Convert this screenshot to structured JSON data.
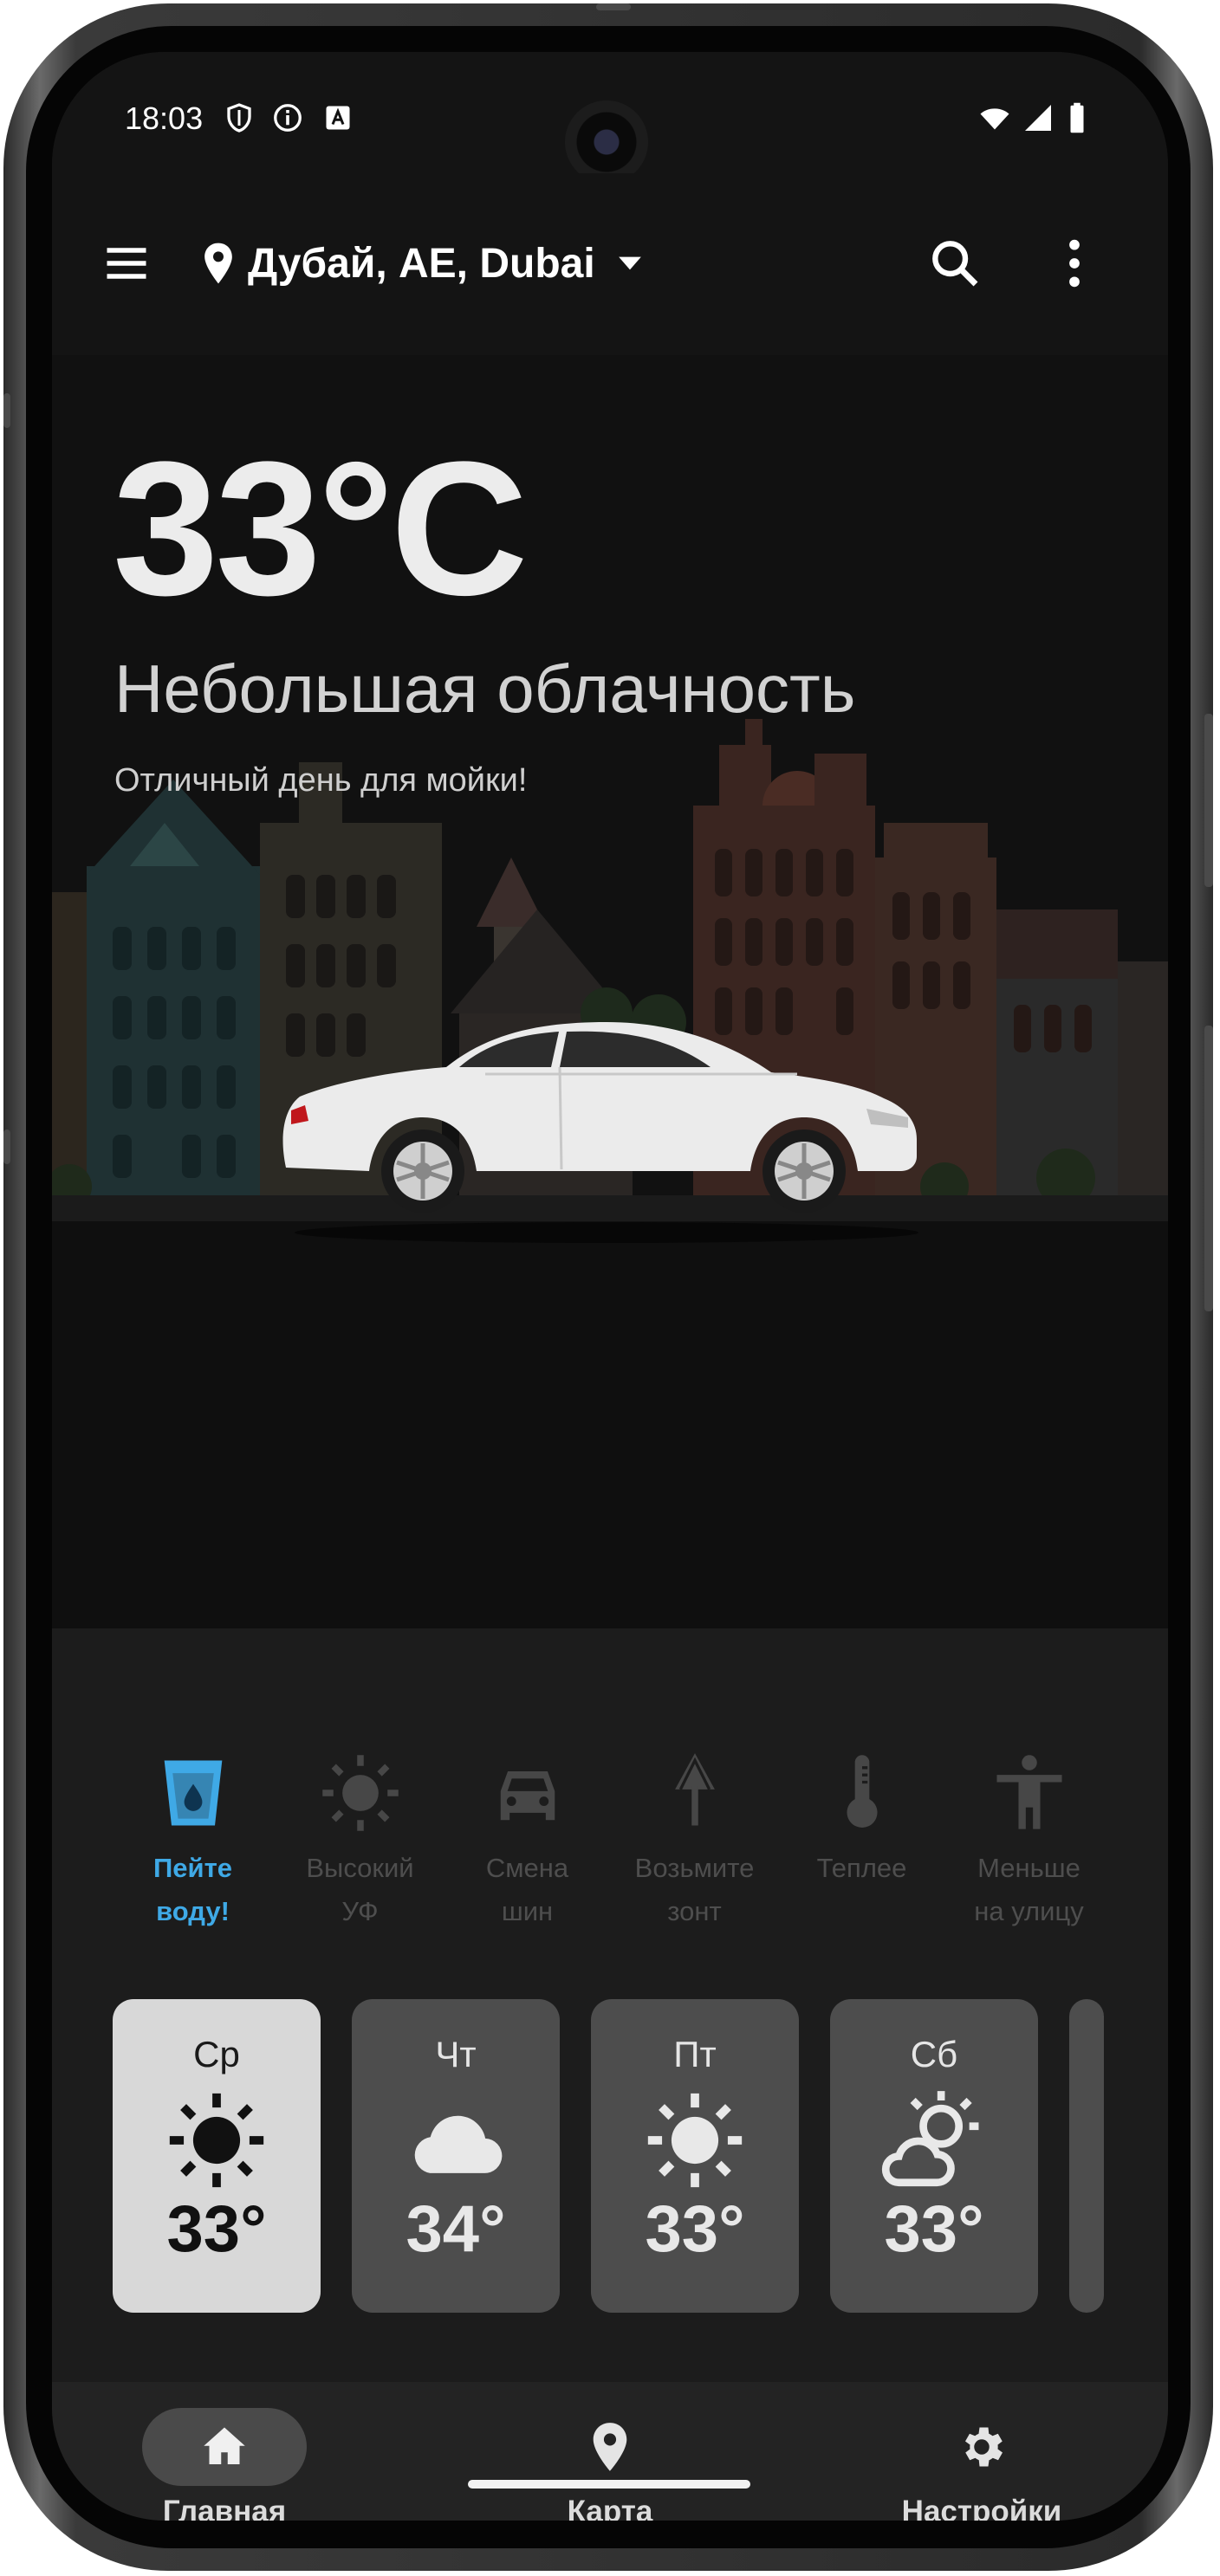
{
  "status_bar": {
    "time": "18:03",
    "icons": [
      "shield-icon",
      "info-icon",
      "keyboard-a-icon",
      "wifi-icon",
      "cell-signal-icon",
      "battery-icon"
    ]
  },
  "app_bar": {
    "location": "Дубай, AE, Dubai",
    "icons": [
      "menu-icon",
      "location-pin-icon",
      "dropdown-arrow-icon",
      "search-icon",
      "more-vert-icon"
    ]
  },
  "current": {
    "temperature": "33°C",
    "condition": "Небольшая облачность",
    "advice": "Отличный день для мойки!"
  },
  "tips": [
    {
      "label": "Пейте\nводу!",
      "icon": "water-glass-icon",
      "active": true
    },
    {
      "label": "Высокий\nУФ",
      "icon": "sun-uv-icon",
      "active": false
    },
    {
      "label": "Смена\nшин",
      "icon": "car-icon",
      "active": false
    },
    {
      "label": "Возьмите\nзонт",
      "icon": "umbrella-icon",
      "active": false
    },
    {
      "label": "Теплее",
      "icon": "thermometer-icon",
      "active": false
    },
    {
      "label": "Меньше\nна улицу",
      "icon": "person-icon",
      "active": false
    }
  ],
  "forecast": [
    {
      "day": "Ср",
      "temp": "33°",
      "icon": "sun-icon",
      "selected": true
    },
    {
      "day": "Чт",
      "temp": "34°",
      "icon": "cloud-icon",
      "selected": false
    },
    {
      "day": "Пт",
      "temp": "33°",
      "icon": "sun-icon",
      "selected": false
    },
    {
      "day": "Сб",
      "temp": "33°",
      "icon": "partly-cloudy-icon",
      "selected": false
    }
  ],
  "bottom_nav": [
    {
      "label": "Главная",
      "icon": "home-icon",
      "active": true
    },
    {
      "label": "Карта",
      "icon": "map-pin-icon",
      "active": false
    },
    {
      "label": "Настройки",
      "icon": "settings-gear-icon",
      "active": false
    }
  ],
  "colors": {
    "background": "#121212",
    "accent": "#3fa9e6",
    "card": "#4d4d4d",
    "card_selected": "#d8d8d8",
    "nav": "#232323"
  }
}
